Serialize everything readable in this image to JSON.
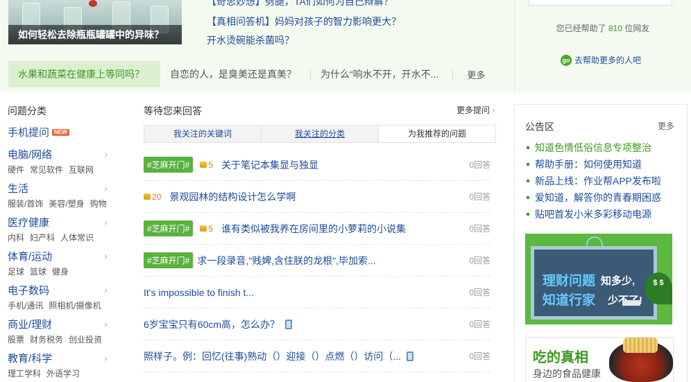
{
  "top": {
    "promo_caption": "如何轻松去除瓶瓶罐罐中的异味？",
    "hot_links": [
      "【奇思妙想】劈腿，TA们如何为自己辩解？",
      "【真相问答机】妈妈对孩子的智力影响更大？",
      "开水烫碗能杀菌吗？"
    ],
    "help_count_prefix": "您已经帮助了",
    "help_count_num": "810",
    "help_count_suffix": "位网友",
    "help_more": "去帮助更多的人吧",
    "go_icon": "go"
  },
  "strip": {
    "active": "水果和蔬菜在健康上等同吗？",
    "items": [
      "自恋的人，是臭美还是真美？",
      "为什么“响水不开，开水不..."
    ],
    "more": "更多"
  },
  "categories": {
    "title": "问题分类",
    "mobile": "手机提问",
    "new_badge": "NEW",
    "items": [
      {
        "name": "电脑/网络",
        "subs": [
          "硬件",
          "常见软件",
          "互联网"
        ]
      },
      {
        "name": "生活",
        "subs": [
          "服装/首饰",
          "美容/塑身",
          "购物"
        ]
      },
      {
        "name": "医疗健康",
        "subs": [
          "内科",
          "妇产科",
          "人体常识"
        ]
      },
      {
        "name": "体育/运动",
        "subs": [
          "足球",
          "篮球",
          "健身"
        ]
      },
      {
        "name": "电子数码",
        "subs": [
          "手机/通讯",
          "照相机/摄像机"
        ]
      },
      {
        "name": "商业/理财",
        "subs": [
          "股票",
          "财务税务",
          "创业投资"
        ]
      },
      {
        "name": "教育/科学",
        "subs": [
          "理工学科",
          "外语学习"
        ]
      }
    ]
  },
  "middle": {
    "title": "等待您来回答",
    "more": "更多提问",
    "tabs": [
      "我关注的关键词",
      "我关注的分类",
      "为我推荐的问题"
    ],
    "questions": [
      {
        "tag": "#芝麻开门#",
        "coin": "5",
        "text": "关于笔记本集显与独显",
        "answers": "0回答"
      },
      {
        "tag": "",
        "coin": "20",
        "text": "景观园林的结构设计怎么学啊",
        "answers": "0回答"
      },
      {
        "tag": "#芝麻开门#",
        "coin": "5",
        "text": "谁有类似被我养在房间里的小萝莉的小说集",
        "answers": "0回答"
      },
      {
        "tag": "#芝麻开门#",
        "coin": "",
        "text": "求一段录音,\"贱婢,含住朕的龙根\",毕加索...",
        "answers": "0回答"
      },
      {
        "tag": "",
        "coin": "",
        "text": "It's impossible to finish t...",
        "answers": "0回答"
      },
      {
        "tag": "",
        "coin": "",
        "text": "6岁宝宝只有60cm高，怎么办？",
        "answers": "0回答",
        "phone": true
      },
      {
        "tag": "",
        "coin": "",
        "text": "照样子。例：回忆(往事)熟动（）迎接（）点燃（）访问（...",
        "answers": "0回答",
        "phone": true
      }
    ]
  },
  "notice": {
    "title": "公告区",
    "more": "更多",
    "items": [
      "知道色情低俗信息专项整治",
      "帮助手册：如何使用知道",
      "新品上线：作业帮APP发布啦",
      "爱知道，解答你的青春期困惑",
      "贴吧首发小米多彩移动电源"
    ]
  },
  "ads": {
    "board_line1a": "理财问题",
    "board_line1b": "知多少,",
    "board_line2a": "知道行家",
    "board_line2b": "少不了!",
    "board_gear": "$ $",
    "food_title": "吃的真相",
    "food_sub": "身边的食品健康"
  }
}
